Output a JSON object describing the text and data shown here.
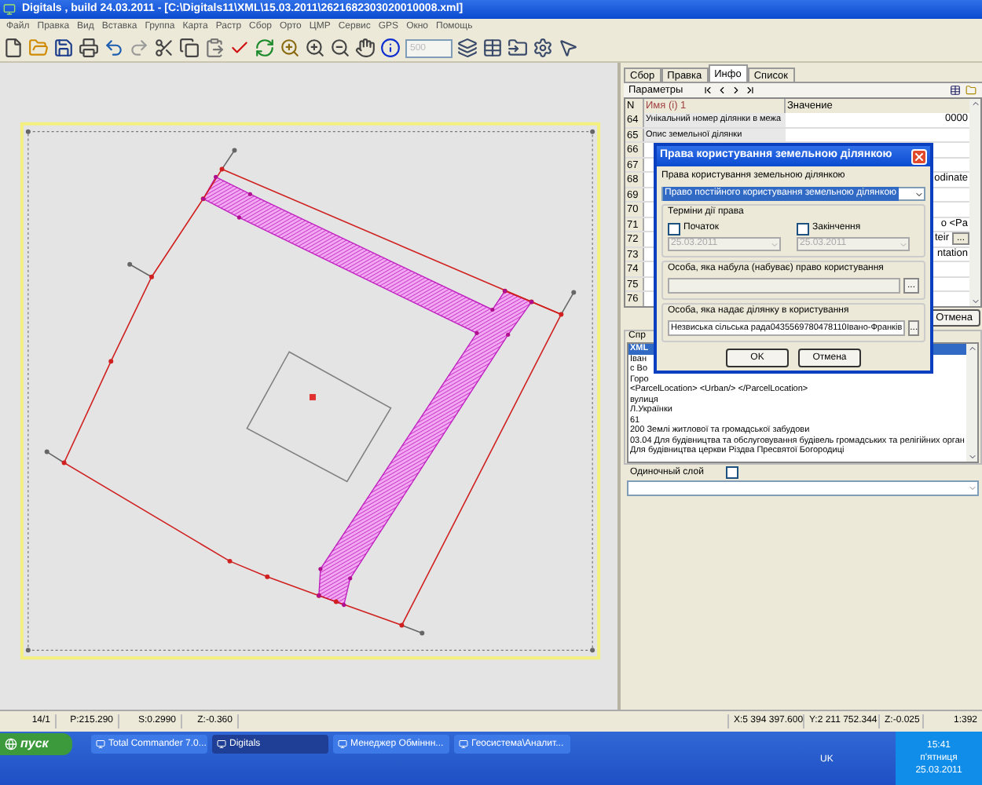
{
  "window": {
    "title": "Digitals , build 24.03.2011 - [C:\\Digitals11\\XML\\15.03.2011\\2621682303020010008.xml]"
  },
  "menu": [
    "Файл",
    "Правка",
    "Вид",
    "Вставка",
    "Группа",
    "Карта",
    "Растр",
    "Сбор",
    "Орто",
    "ЦМР",
    "Сервис",
    "GPS",
    "Окно",
    "Помощь"
  ],
  "toolbar": {
    "scale_field": {
      "placeholder": "500",
      "disabled": true
    }
  },
  "side_panel": {
    "tabs": [
      {
        "label": "Сбор",
        "selected": false
      },
      {
        "label": "Правка",
        "selected": false
      },
      {
        "label": "Инфо",
        "selected": true
      },
      {
        "label": "Список",
        "selected": false
      }
    ],
    "params_label": "Параметры",
    "table": {
      "columns": [
        "N",
        "Имя (i) 1",
        "Значение"
      ],
      "rows": [
        {
          "n": "64",
          "name": "Унікальний номер ділянки в межа",
          "value": "0000"
        },
        {
          "n": "65",
          "name": "Опис земельної ділянки"
        },
        {
          "n": "66"
        },
        {
          "n": "67"
        },
        {
          "n": "68",
          "value": "odinate"
        },
        {
          "n": "69"
        },
        {
          "n": "70"
        },
        {
          "n": "71",
          "value": "o <Pa"
        },
        {
          "n": "72",
          "value": "teir",
          "action": "..."
        },
        {
          "n": "73",
          "value": "ntation"
        },
        {
          "n": "74"
        },
        {
          "n": "75"
        },
        {
          "n": "76"
        }
      ]
    },
    "cancel_button": "Отмена",
    "group_label": "Спр",
    "list": [
      {
        "text": "XML",
        "selected": true
      },
      {
        "text": "Іван",
        "selected": false
      },
      {
        "text": "с Во",
        "selected": false
      },
      {
        "text": "Горо",
        "selected": false
      },
      {
        "text": "<ParcelLocation> <Urban/> </ParcelLocation>",
        "selected": false
      },
      {
        "text": "вулиця",
        "selected": false
      },
      {
        "text": "Л.Українки",
        "selected": false
      },
      {
        "text": "61",
        "selected": false
      },
      {
        "text": "200 Землі житлової та громадської забудови",
        "selected": false
      },
      {
        "text": "03.04  Для будівництва та обслуговування будівель громадських та релігійних орган",
        "selected": false
      },
      {
        "text": "Для будівництва церкви Різдва Пресвятої Богородиці",
        "selected": false
      }
    ],
    "single_layer": {
      "label": "Одиночный слой",
      "checked": false
    }
  },
  "dialog": {
    "title": "Права користування земельною ділянкою",
    "rights_label": "Права користування земельною ділянкою",
    "rights_value": "Право постійного користування земельною ділянкою",
    "terms_label": "Терміни дії права",
    "terms": [
      {
        "label": "Початок",
        "checked": false,
        "date": "25.03.2011",
        "disabled": true
      },
      {
        "label": "Закінчення",
        "checked": false,
        "date": "25.03.2011",
        "disabled": true
      }
    ],
    "persons": [
      {
        "label": "Особа, яка набула (набуває) право користування",
        "button": "..."
      },
      {
        "label": "Особа, яка надає ділянку в користування",
        "value": "Незвиська сільська рада0435569780478110Івано-Франків",
        "button": "..."
      }
    ],
    "buttons": [
      "OK",
      "Отмена"
    ]
  },
  "status_bar": {
    "left": [
      "14/1",
      "P:215.290",
      "S:0.2990",
      "Z:-0.360"
    ],
    "right": [
      "X:5 394 397.600",
      "Y:2 211 752.344",
      "Z:-0.025",
      "1:392"
    ]
  },
  "taskbar": {
    "start": "пуск",
    "items": [
      {
        "label": "Total Commander 7.0...",
        "selected": false
      },
      {
        "label": "Digitals",
        "selected": true
      },
      {
        "label": "Менеджер Обміннн...",
        "selected": false
      },
      {
        "label": "Геосистема\\Аналит...",
        "selected": false
      }
    ],
    "lang": "UK",
    "clock": {
      "time": "15:41",
      "day": "п'ятниця",
      "date": "25.03.2011"
    }
  }
}
